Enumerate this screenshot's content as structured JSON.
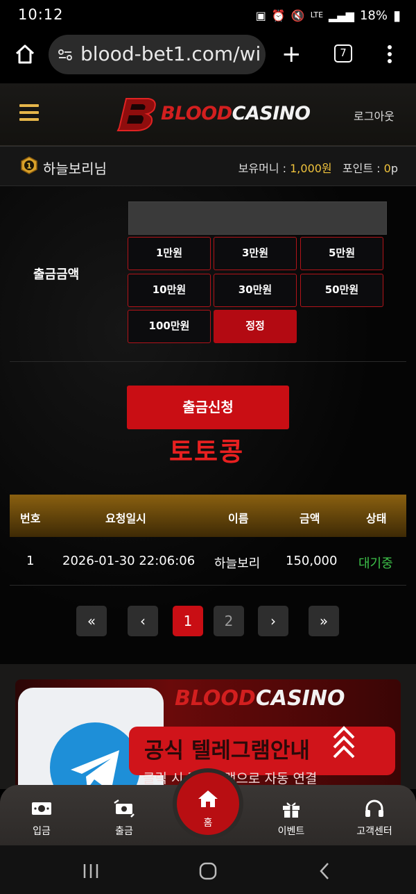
{
  "status": {
    "time": "10:12",
    "network": "LTE",
    "battery": "18%"
  },
  "browser": {
    "url": "blood-bet1.com/wi",
    "tab_count": "7"
  },
  "site": {
    "logo": {
      "part1": "BLOOD",
      "part2": "CASINO"
    },
    "logout": "로그아웃"
  },
  "user": {
    "level": "1",
    "name": "하늘보리님",
    "money_label": "보유머니 : ",
    "money_value": "1,000원",
    "point_label": "포인트 : ",
    "point_value": "0",
    "point_unit": "p"
  },
  "withdraw": {
    "amount_label": "출금금액",
    "amount_value": "",
    "buttons": [
      "1만원",
      "3만원",
      "5만원",
      "10만원",
      "30만원",
      "50만원",
      "100만원",
      "정정"
    ],
    "submit": "출금신청",
    "watermark": "토토콩"
  },
  "table": {
    "headers": [
      "번호",
      "요청일시",
      "이름",
      "금액",
      "상태"
    ],
    "rows": [
      {
        "no": "1",
        "datetime": "2026-01-30 22:06:06",
        "name": "하늘보리",
        "amount": "150,000",
        "status": "대기중"
      }
    ]
  },
  "pagination": {
    "first": "«",
    "prev": "‹",
    "pages": [
      "1",
      "2"
    ],
    "current": "1",
    "next": "›",
    "last": "»"
  },
  "banner": {
    "logo_part1": "BLOOD",
    "logo_part2": "CASINO",
    "title": "공식 텔레그램안내",
    "subtitle": "클릭 시 텔레그램으로 자동 연결",
    "icon": "telegram-icon"
  },
  "nav": {
    "deposit": "입금",
    "withdraw": "출금",
    "home": "홈",
    "event": "이벤트",
    "support": "고객센터"
  },
  "colors": {
    "accent": "#c90e14",
    "gold": "#e6b64a",
    "status_waiting": "#3ec24a",
    "money": "#f0c33c"
  }
}
